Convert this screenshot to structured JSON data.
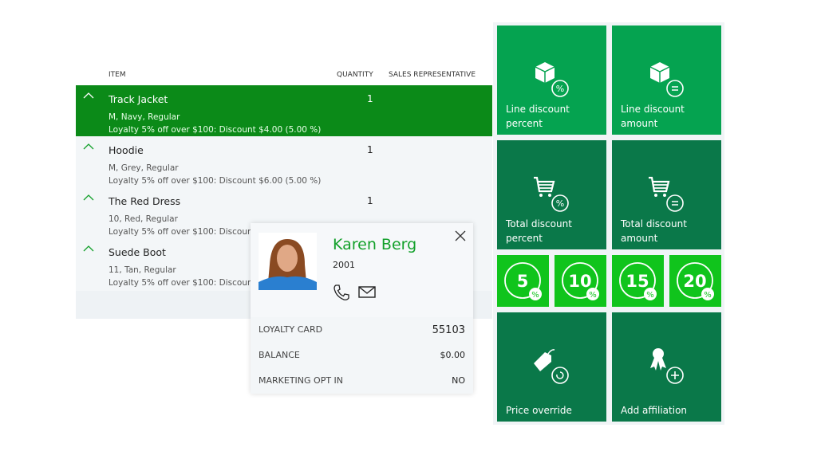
{
  "table": {
    "headers": {
      "item": "ITEM",
      "quantity": "QUANTITY",
      "sales_rep": "SALES REPRESENTATIVE"
    },
    "rows": [
      {
        "name": "Track Jacket",
        "qty": "1",
        "variant": "M, Navy, Regular",
        "discount": "Loyalty 5% off over $100: Discount $4.00 (5.00 %)",
        "selected": true
      },
      {
        "name": "Hoodie",
        "qty": "1",
        "variant": "M, Grey, Regular",
        "discount": "Loyalty 5% off over $100: Discount $6.00 (5.00 %)"
      },
      {
        "name": "The Red Dress",
        "qty": "1",
        "variant": "10, Red, Regular",
        "discount": "Loyalty 5% off over $100: Discount $7"
      },
      {
        "name": "Suede Boot",
        "qty": "",
        "variant": "11, Tan, Regular",
        "discount": "Loyalty 5% off over $100: Discount $6"
      }
    ]
  },
  "customer": {
    "name": "Karen Berg",
    "id": "2001",
    "fields": [
      {
        "label": "LOYALTY CARD",
        "value": "55103"
      },
      {
        "label": "BALANCE",
        "value": "$0.00"
      },
      {
        "label": "MARKETING OPT IN",
        "value": "NO"
      }
    ]
  },
  "tiles": {
    "line_pct": "Line discount percent",
    "line_amt": "Line discount amount",
    "total_pct": "Total discount percent",
    "total_amt": "Total discount amount",
    "quick": [
      "5",
      "10",
      "15",
      "20"
    ],
    "pct_symbol": "%",
    "price_override": "Price override",
    "add_affiliation": "Add affiliation"
  },
  "colors": {
    "selected_row": "#0b8a18",
    "tile_light": "#05a350",
    "tile_dark": "#0a7849",
    "tile_bright": "#10c41c",
    "accent_name": "#12a02a"
  }
}
